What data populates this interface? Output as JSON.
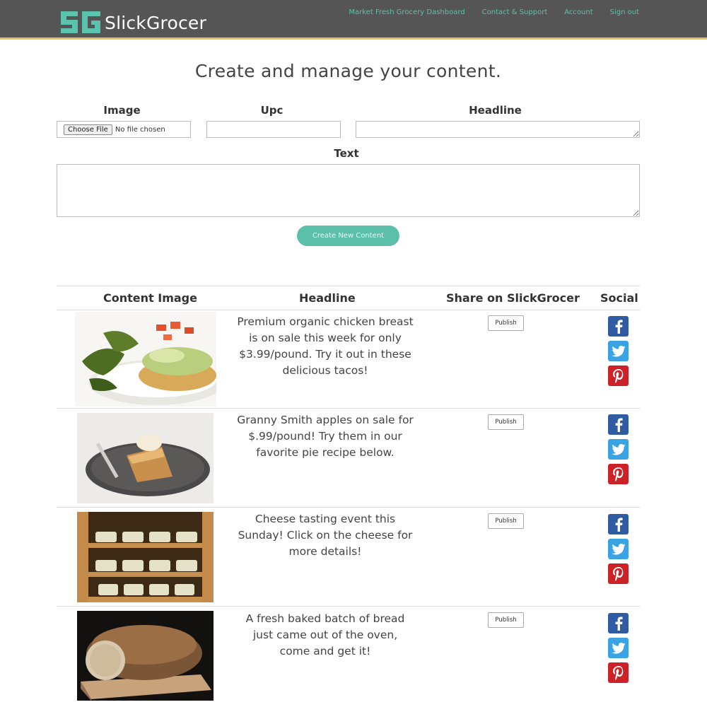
{
  "header": {
    "logo_text": "SlickGrocer",
    "nav": [
      "Market Fresh Grocery Dashboard",
      "Contact & Support",
      "Account",
      "Sign out"
    ],
    "accent_color": "#5bc2ab",
    "bar_color": "#555555"
  },
  "page": {
    "title": "Create and manage your content."
  },
  "form": {
    "image_label": "Image",
    "upc_label": "Upc",
    "headline_label": "Headline",
    "text_label": "Text",
    "file_button": "Choose File",
    "file_status": "No file chosen",
    "upc_value": "",
    "headline_value": "",
    "text_value": "",
    "submit_label": "Create New Content"
  },
  "table": {
    "headers": [
      "Content Image",
      "Headline",
      "Share on SlickGrocer",
      "Social"
    ],
    "publish_label": "Publish",
    "rows": [
      {
        "image": "tacos-photo",
        "headline": "Premium organic chicken breast is on sale this week for only $3.99/pound. Try it out in these delicious tacos!"
      },
      {
        "image": "apple-pie-photo",
        "headline": "Granny Smith apples on sale for $.99/pound! Try them in our favorite pie recipe below."
      },
      {
        "image": "cheese-shelves-photo",
        "headline": "Cheese tasting event this Sunday! Click on the cheese for more details!"
      },
      {
        "image": "bread-loaf-photo",
        "headline": "A fresh baked batch of bread just came out of the oven, come and get it!"
      }
    ],
    "social_icons": [
      "facebook-icon",
      "twitter-icon",
      "pinterest-icon"
    ]
  }
}
